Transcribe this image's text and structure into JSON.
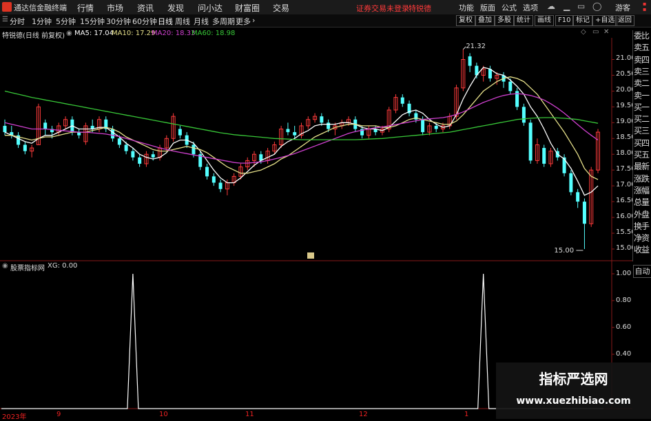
{
  "titlebar": {
    "app_name": "通达信金融终端",
    "menu": [
      "行情",
      "市场",
      "资讯",
      "发现",
      "问小达",
      "财富圈",
      "交易"
    ],
    "warning": "证券交易未登录",
    "stock_tag": "特锐德",
    "right_menu": [
      "功能",
      "版面",
      "公式",
      "选项"
    ],
    "guest": "游客"
  },
  "toolbar": {
    "periods": [
      "分时",
      "1分钟",
      "5分钟",
      "15分钟",
      "30分钟",
      "60分钟",
      "日线",
      "周线",
      "月线",
      "多周期",
      "更多"
    ],
    "active_period": "日线",
    "right_buttons": [
      "复权",
      "叠加",
      "多股",
      "统计",
      "画线",
      "F10",
      "标记",
      "+自选",
      "返回"
    ]
  },
  "main_chart": {
    "legend_title": "特锐德(日线 前复权)",
    "ma": [
      {
        "label": "MA5: 17.04",
        "color": "#ffffff"
      },
      {
        "label": "MA10: 17.29",
        "color": "#e6e08a"
      },
      {
        "label": "MA20: 18.33",
        "color": "#d040d0"
      },
      {
        "label": "MA60: 18.98",
        "color": "#38c838"
      }
    ]
  },
  "sub_chart": {
    "legend_title": "股票指标网",
    "legend_value": "XG: 0.00",
    "y_ticks": [
      "1.00",
      "0.80",
      "0.60",
      "0.40"
    ]
  },
  "side_panel": {
    "items": [
      "委比",
      "卖五",
      "卖四",
      "卖三",
      "卖二",
      "卖一",
      "买一",
      "买二",
      "买三",
      "买四",
      "买五",
      "最新",
      "涨跌",
      "涨幅",
      "总量",
      "外盘",
      "换手",
      "净资",
      "收益"
    ],
    "auto_button": "自动"
  },
  "x_axis": {
    "labels": [
      "2023年",
      "9",
      "10",
      "11",
      "12",
      "1"
    ]
  },
  "watermark": {
    "title": "指标严选网",
    "url": "www.xuezhibiao.com"
  },
  "chart_data": {
    "type": "candlestick",
    "y_ticks": [
      "21.00",
      "20.50",
      "20.00",
      "19.50",
      "19.00",
      "18.50",
      "18.00",
      "17.50",
      "17.00",
      "16.50",
      "16.00",
      "15.50",
      "15.00"
    ],
    "ylim": [
      14.8,
      21.6
    ],
    "annotations": [
      {
        "text": "21.32",
        "value": 21.32
      },
      {
        "text": "15.00",
        "value": 15.0
      }
    ],
    "candles": [
      [
        18.9,
        19.1,
        18.6,
        18.7
      ],
      [
        18.7,
        18.9,
        18.5,
        18.6
      ],
      [
        18.6,
        18.7,
        18.2,
        18.3
      ],
      [
        18.3,
        18.4,
        18.0,
        18.1
      ],
      [
        18.1,
        18.3,
        17.9,
        18.2
      ],
      [
        18.3,
        19.6,
        18.3,
        19.5
      ],
      [
        19.0,
        19.1,
        18.6,
        18.8
      ],
      [
        18.8,
        18.9,
        18.5,
        18.7
      ],
      [
        18.7,
        19.0,
        18.6,
        18.9
      ],
      [
        18.9,
        19.2,
        18.8,
        19.1
      ],
      [
        19.1,
        19.2,
        18.6,
        18.7
      ],
      [
        18.7,
        18.8,
        18.5,
        18.6
      ],
      [
        18.4,
        19.0,
        18.3,
        18.9
      ],
      [
        18.9,
        19.1,
        18.7,
        18.8
      ],
      [
        18.8,
        19.2,
        18.7,
        19.1
      ],
      [
        19.1,
        19.2,
        18.7,
        18.8
      ],
      [
        18.8,
        18.9,
        18.4,
        18.5
      ],
      [
        18.5,
        18.6,
        18.2,
        18.3
      ],
      [
        18.3,
        18.4,
        18.0,
        18.1
      ],
      [
        18.1,
        18.2,
        17.8,
        17.9
      ],
      [
        17.9,
        18.0,
        17.6,
        17.7
      ],
      [
        17.7,
        18.1,
        17.6,
        18.0
      ],
      [
        18.0,
        18.1,
        17.8,
        17.9
      ],
      [
        17.9,
        18.3,
        17.8,
        18.2
      ],
      [
        18.2,
        18.6,
        18.1,
        18.5
      ],
      [
        18.5,
        19.3,
        18.4,
        19.2
      ],
      [
        18.8,
        18.9,
        18.5,
        18.6
      ],
      [
        18.6,
        18.7,
        18.2,
        18.3
      ],
      [
        18.3,
        18.4,
        17.9,
        18.0
      ],
      [
        18.0,
        18.1,
        17.5,
        17.6
      ],
      [
        17.6,
        17.7,
        17.2,
        17.3
      ],
      [
        17.3,
        17.4,
        17.0,
        17.1
      ],
      [
        17.1,
        17.2,
        16.8,
        16.9
      ],
      [
        16.9,
        17.2,
        16.7,
        17.1
      ],
      [
        17.1,
        17.4,
        17.0,
        17.3
      ],
      [
        17.3,
        17.7,
        17.2,
        17.6
      ],
      [
        17.6,
        17.9,
        17.5,
        17.8
      ],
      [
        17.8,
        18.1,
        17.6,
        18.0
      ],
      [
        18.0,
        18.1,
        17.7,
        17.8
      ],
      [
        17.8,
        18.2,
        17.7,
        18.1
      ],
      [
        18.1,
        18.4,
        18.0,
        18.3
      ],
      [
        18.3,
        18.9,
        18.2,
        18.8
      ],
      [
        18.8,
        19.0,
        18.6,
        18.7
      ],
      [
        18.7,
        18.9,
        18.5,
        18.6
      ],
      [
        18.6,
        19.0,
        18.5,
        18.9
      ],
      [
        18.9,
        19.2,
        18.8,
        19.1
      ],
      [
        19.1,
        19.3,
        19.0,
        19.2
      ],
      [
        19.2,
        19.3,
        18.9,
        19.0
      ],
      [
        19.0,
        19.1,
        18.7,
        18.8
      ],
      [
        18.8,
        19.0,
        18.6,
        18.9
      ],
      [
        18.9,
        19.1,
        18.8,
        19.0
      ],
      [
        19.0,
        19.2,
        18.9,
        19.1
      ],
      [
        19.1,
        19.2,
        18.7,
        18.8
      ],
      [
        18.8,
        18.9,
        18.5,
        18.6
      ],
      [
        18.6,
        18.9,
        18.5,
        18.8
      ],
      [
        18.8,
        18.9,
        18.6,
        18.7
      ],
      [
        18.7,
        18.9,
        18.6,
        18.8
      ],
      [
        18.8,
        19.5,
        18.7,
        19.4
      ],
      [
        19.4,
        19.9,
        19.3,
        19.8
      ],
      [
        19.8,
        19.9,
        19.5,
        19.6
      ],
      [
        19.6,
        19.7,
        19.2,
        19.3
      ],
      [
        19.3,
        19.4,
        19.0,
        19.1
      ],
      [
        19.1,
        19.2,
        18.6,
        18.7
      ],
      [
        18.7,
        19.0,
        18.6,
        18.9
      ],
      [
        18.9,
        19.0,
        18.7,
        18.8
      ],
      [
        18.8,
        19.0,
        18.7,
        18.9
      ],
      [
        18.9,
        19.3,
        18.8,
        19.2
      ],
      [
        19.2,
        20.2,
        19.1,
        20.1
      ],
      [
        20.1,
        21.32,
        20.0,
        21.0
      ],
      [
        21.1,
        21.2,
        20.6,
        20.8
      ],
      [
        20.8,
        20.9,
        20.4,
        20.5
      ],
      [
        20.5,
        20.8,
        20.3,
        20.7
      ],
      [
        20.7,
        20.8,
        20.3,
        20.4
      ],
      [
        20.4,
        20.6,
        20.2,
        20.5
      ],
      [
        20.5,
        20.6,
        20.1,
        20.3
      ],
      [
        20.3,
        20.4,
        19.9,
        20.0
      ],
      [
        20.0,
        20.1,
        19.4,
        19.5
      ],
      [
        19.5,
        19.6,
        18.9,
        19.0
      ],
      [
        19.0,
        19.1,
        17.7,
        17.8
      ],
      [
        17.8,
        18.5,
        17.7,
        18.3
      ],
      [
        18.2,
        18.3,
        17.6,
        17.7
      ],
      [
        17.7,
        18.2,
        17.6,
        18.1
      ],
      [
        18.1,
        18.2,
        17.8,
        17.9
      ],
      [
        17.9,
        18.0,
        17.3,
        17.4
      ],
      [
        17.4,
        17.5,
        16.7,
        16.8
      ],
      [
        16.8,
        16.9,
        16.3,
        16.5
      ],
      [
        16.5,
        16.6,
        15.0,
        15.8
      ],
      [
        15.8,
        17.6,
        15.7,
        17.5
      ],
      [
        17.5,
        18.8,
        17.4,
        18.7
      ]
    ],
    "series": [
      {
        "name": "MA5",
        "color": "#ffffff",
        "values": [
          18.7,
          18.6,
          18.5,
          18.4,
          18.35,
          18.5,
          18.6,
          18.6,
          18.7,
          18.8,
          18.9,
          18.8,
          18.8,
          18.8,
          18.85,
          18.85,
          18.7,
          18.55,
          18.35,
          18.2,
          18.0,
          17.9,
          17.85,
          17.9,
          18.05,
          18.35,
          18.45,
          18.45,
          18.35,
          18.1,
          17.8,
          17.5,
          17.25,
          17.1,
          17.1,
          17.25,
          17.45,
          17.65,
          17.8,
          17.9,
          18.0,
          18.25,
          18.4,
          18.5,
          18.65,
          18.75,
          18.9,
          18.95,
          18.95,
          18.95,
          19.0,
          19.0,
          18.95,
          18.85,
          18.8,
          18.8,
          18.75,
          18.85,
          19.05,
          19.25,
          19.35,
          19.4,
          19.3,
          19.1,
          18.95,
          18.85,
          18.9,
          19.25,
          19.75,
          20.15,
          20.5,
          20.75,
          20.7,
          20.55,
          20.5,
          20.35,
          20.15,
          19.9,
          19.5,
          19.2,
          18.8,
          18.35,
          18.0,
          17.85,
          17.55,
          17.15,
          16.7,
          16.8,
          17.0
        ]
      },
      {
        "name": "MA10",
        "color": "#e6e08a",
        "values": [
          18.6,
          18.6,
          18.55,
          18.5,
          18.45,
          18.5,
          18.55,
          18.55,
          18.6,
          18.65,
          18.7,
          18.7,
          18.7,
          18.75,
          18.8,
          18.85,
          18.8,
          18.7,
          18.55,
          18.45,
          18.35,
          18.25,
          18.15,
          18.1,
          18.1,
          18.15,
          18.2,
          18.25,
          18.2,
          18.15,
          18.05,
          17.9,
          17.75,
          17.6,
          17.5,
          17.4,
          17.4,
          17.45,
          17.5,
          17.6,
          17.7,
          17.85,
          17.95,
          18.1,
          18.25,
          18.4,
          18.55,
          18.65,
          18.75,
          18.85,
          18.9,
          18.95,
          18.95,
          18.9,
          18.9,
          18.9,
          18.85,
          18.85,
          18.9,
          19.0,
          19.1,
          19.15,
          19.1,
          19.05,
          19.0,
          18.95,
          18.95,
          19.05,
          19.25,
          19.5,
          19.75,
          20.0,
          20.15,
          20.3,
          20.4,
          20.45,
          20.4,
          20.3,
          20.1,
          19.9,
          19.6,
          19.3,
          19.0,
          18.7,
          18.35,
          18.0,
          17.55,
          17.3,
          17.2
        ]
      },
      {
        "name": "MA20",
        "color": "#d040d0",
        "values": [
          19.0,
          18.95,
          18.9,
          18.85,
          18.8,
          18.8,
          18.8,
          18.78,
          18.76,
          18.74,
          18.72,
          18.7,
          18.7,
          18.68,
          18.66,
          18.64,
          18.6,
          18.56,
          18.5,
          18.44,
          18.38,
          18.32,
          18.26,
          18.2,
          18.15,
          18.1,
          18.06,
          18.02,
          17.98,
          17.94,
          17.9,
          17.86,
          17.82,
          17.78,
          17.74,
          17.72,
          17.72,
          17.74,
          17.76,
          17.8,
          17.85,
          17.9,
          17.96,
          18.02,
          18.1,
          18.18,
          18.26,
          18.34,
          18.42,
          18.5,
          18.58,
          18.66,
          18.72,
          18.76,
          18.8,
          18.84,
          18.86,
          18.9,
          18.94,
          18.98,
          19.02,
          19.06,
          19.1,
          19.12,
          19.14,
          19.16,
          19.2,
          19.26,
          19.34,
          19.44,
          19.54,
          19.64,
          19.72,
          19.8,
          19.86,
          19.9,
          19.92,
          19.9,
          19.86,
          19.8,
          19.72,
          19.6,
          19.46,
          19.3,
          19.12,
          18.94,
          18.76,
          18.6,
          18.45
        ]
      },
      {
        "name": "MA60",
        "color": "#38c838",
        "values": [
          20.0,
          19.95,
          19.9,
          19.85,
          19.8,
          19.76,
          19.72,
          19.68,
          19.64,
          19.6,
          19.56,
          19.52,
          19.48,
          19.44,
          19.4,
          19.36,
          19.32,
          19.28,
          19.24,
          19.2,
          19.16,
          19.12,
          19.08,
          19.04,
          19.0,
          18.96,
          18.92,
          18.88,
          18.84,
          18.8,
          18.76,
          18.72,
          18.68,
          18.65,
          18.62,
          18.6,
          18.58,
          18.56,
          18.54,
          18.52,
          18.5,
          18.49,
          18.48,
          18.47,
          18.46,
          18.46,
          18.46,
          18.46,
          18.46,
          18.46,
          18.46,
          18.46,
          18.46,
          18.47,
          18.48,
          18.49,
          18.5,
          18.52,
          18.54,
          18.56,
          18.58,
          18.6,
          18.62,
          18.64,
          18.66,
          18.68,
          18.7,
          18.74,
          18.78,
          18.82,
          18.86,
          18.9,
          18.94,
          18.98,
          19.02,
          19.06,
          19.1,
          19.12,
          19.14,
          19.15,
          19.16,
          19.16,
          19.15,
          19.14,
          19.12,
          19.1,
          19.06,
          19.02,
          18.98
        ]
      }
    ],
    "sub_series": {
      "name": "XG",
      "values_by_bar": {
        "19": 1,
        "71": 1
      },
      "ylim": [
        0,
        1.0
      ]
    }
  }
}
